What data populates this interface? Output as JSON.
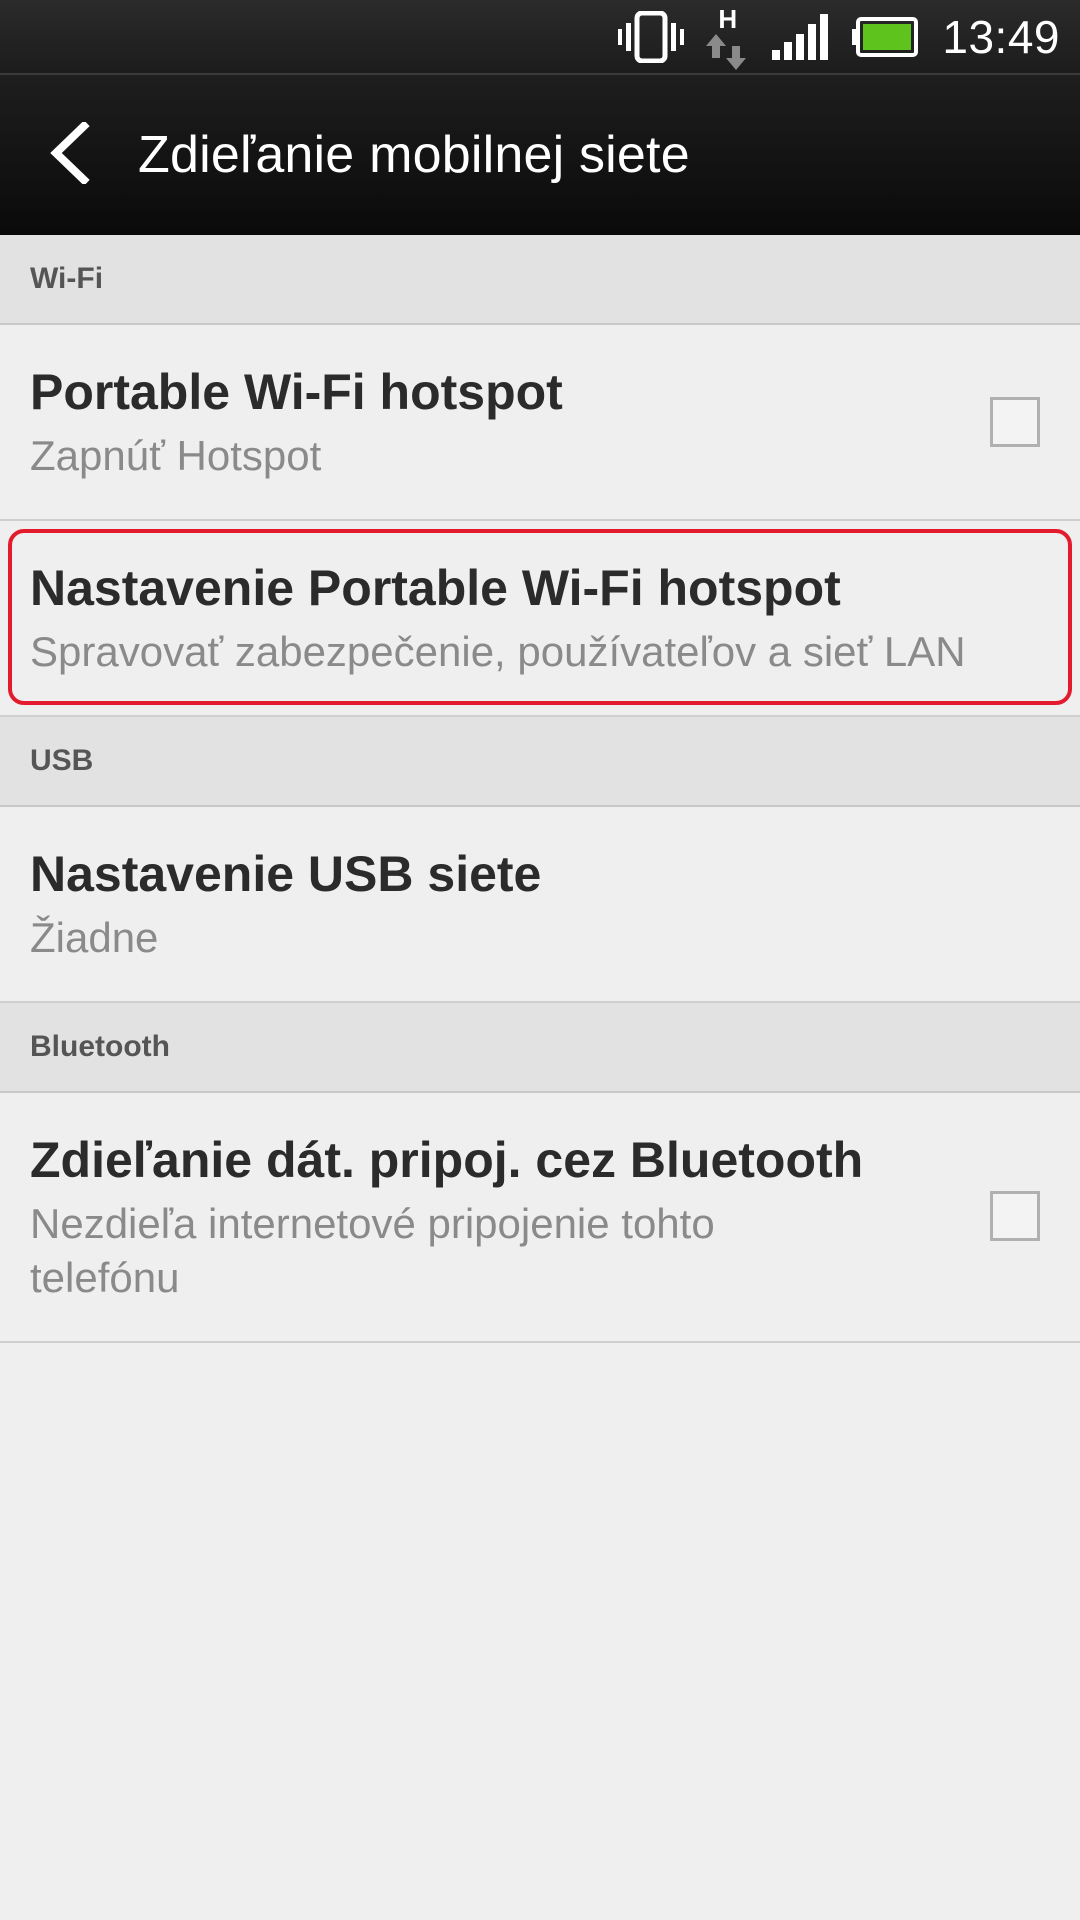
{
  "status_bar": {
    "time": "13:49",
    "network_label": "H",
    "icons": [
      "vibrate-icon",
      "network-h-data-icon",
      "signal-icon",
      "battery-icon"
    ],
    "battery_color": "#5fc31e"
  },
  "action_bar": {
    "back_icon": "back-arrow-icon",
    "title": "Zdieľanie mobilnej siete"
  },
  "sections": {
    "wifi": {
      "header": "Wi-Fi",
      "hotspot": {
        "title": "Portable Wi-Fi hotspot",
        "subtitle": "Zapnúť Hotspot",
        "checked": false
      },
      "hotspot_settings": {
        "title": "Nastavenie Portable Wi-Fi hotspot",
        "subtitle": "Spravovať zabezpečenie, používateľov a sieť LAN",
        "highlight_color": "#e31b2c"
      }
    },
    "usb": {
      "header": "USB",
      "usb_settings": {
        "title": "Nastavenie USB siete",
        "subtitle": "Žiadne"
      }
    },
    "bluetooth": {
      "header": "Bluetooth",
      "bt_tethering": {
        "title": "Zdieľanie dát. pripoj. cez Bluetooth",
        "subtitle_line1": "Nezdieľa internetové pripojenie tohto",
        "subtitle_line2": "telefónu",
        "checked": false
      }
    }
  }
}
